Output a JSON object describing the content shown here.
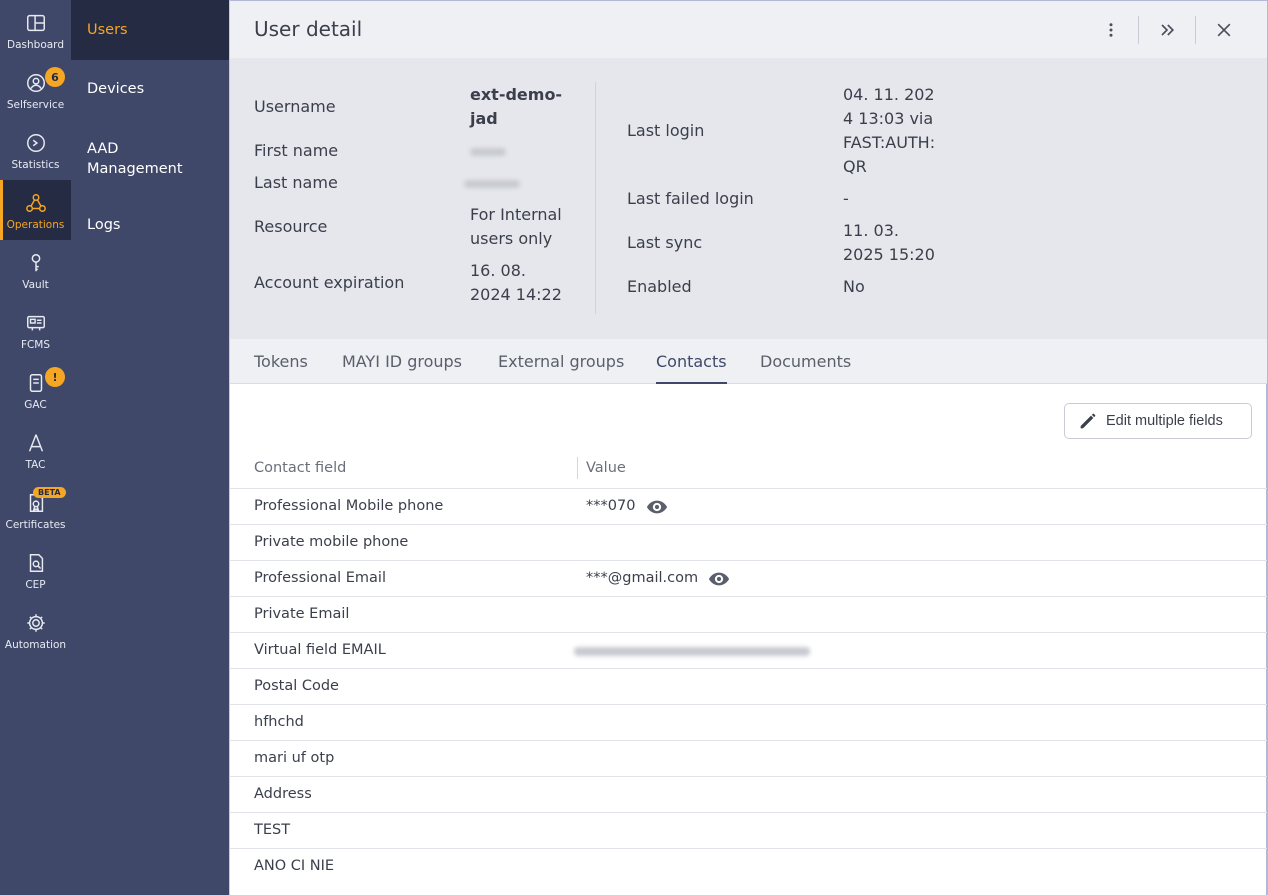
{
  "rail": [
    {
      "id": "dashboard",
      "label": "Dashboard",
      "icon": "dashboard-icon"
    },
    {
      "id": "selfservice",
      "label": "Selfservice",
      "icon": "user-circle-icon",
      "badge": "6"
    },
    {
      "id": "statistics",
      "label": "Statistics",
      "icon": "gauge-icon"
    },
    {
      "id": "operations",
      "label": "Operations",
      "icon": "network-icon",
      "active": true
    },
    {
      "id": "vault",
      "label": "Vault",
      "icon": "key-icon"
    },
    {
      "id": "fcms",
      "label": "FCMS",
      "icon": "card-stack-icon"
    },
    {
      "id": "gac",
      "label": "GAC",
      "icon": "phone-device-icon",
      "badge": "!"
    },
    {
      "id": "tac",
      "label": "TAC",
      "icon": "antenna-icon"
    },
    {
      "id": "certificates",
      "label": "Certificates",
      "icon": "certificate-icon",
      "badge": "BETA"
    },
    {
      "id": "cep",
      "label": "CEP",
      "icon": "document-search-icon"
    },
    {
      "id": "automation",
      "label": "Automation",
      "icon": "gear-icon"
    }
  ],
  "subnav": [
    {
      "label": "Users",
      "active": true
    },
    {
      "label": "Devices"
    },
    {
      "label": "AAD Management"
    },
    {
      "label": "Logs"
    }
  ],
  "header": {
    "title": "User detail"
  },
  "details": {
    "username_label": "Username",
    "username_value": "ext-demo-jad",
    "first_name_label": "First name",
    "last_name_label": "Last name",
    "resource_label": "Resource",
    "resource_value": "For Internal users only",
    "account_expiration_label": "Account expiration",
    "account_expiration_value": "16. 08. 2024 14:22",
    "last_login_label": "Last login",
    "last_login_value": "04. 11. 2024 13:03 via FAST:AUTH:QR",
    "last_failed_login_label": "Last failed login",
    "last_failed_login_value": "-",
    "last_sync_label": "Last sync",
    "last_sync_value": "11. 03. 2025 15:20",
    "enabled_label": "Enabled",
    "enabled_value": "No"
  },
  "tabs": [
    "Tokens",
    "MAYI ID groups",
    "External groups",
    "Contacts",
    "Documents"
  ],
  "active_tab": "Contacts",
  "edit_button_label": "Edit multiple fields",
  "table": {
    "columns": [
      "Contact field",
      "Value"
    ],
    "rows": [
      {
        "field": "Professional Mobile phone",
        "value": "***070",
        "eye": true
      },
      {
        "field": "Private mobile phone",
        "value": ""
      },
      {
        "field": "Professional Email",
        "value": "***@gmail.com",
        "eye": true
      },
      {
        "field": "Private Email",
        "value": ""
      },
      {
        "field": "Virtual field EMAIL",
        "value": "",
        "blurred": true
      },
      {
        "field": "Postal Code",
        "value": ""
      },
      {
        "field": "hfhchd",
        "value": ""
      },
      {
        "field": "mari uf otp",
        "value": ""
      },
      {
        "field": "Address",
        "value": ""
      },
      {
        "field": "TEST",
        "value": ""
      },
      {
        "field": "ANO CI NIE",
        "value": ""
      }
    ]
  },
  "colors": {
    "rail_bg": "#3f4868",
    "active_bg": "#262b44",
    "accent": "#f5a623"
  }
}
